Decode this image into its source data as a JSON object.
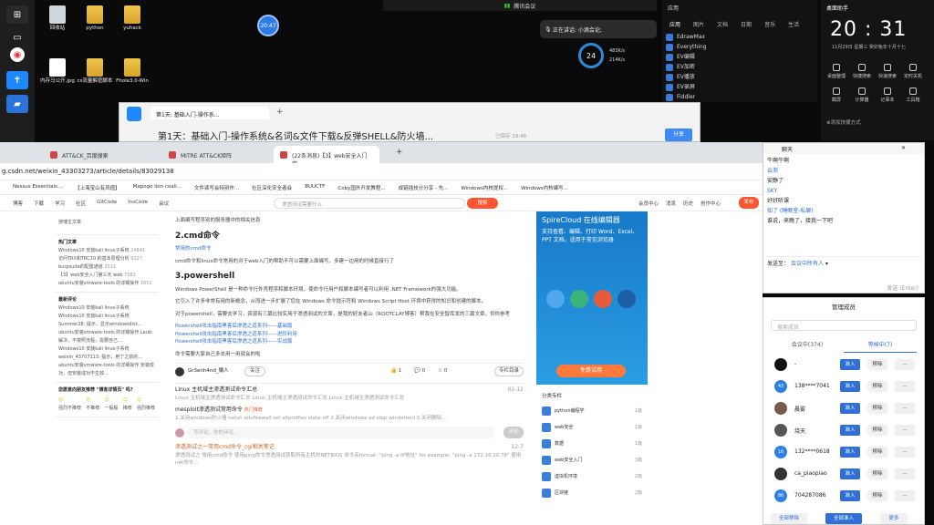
{
  "desktop": {
    "icons": [
      {
        "label": "回收站"
      },
      {
        "label": "python"
      },
      {
        "label": "yuhack"
      },
      {
        "label": "内存马公开.jpg"
      },
      {
        "label": "cs流量解密脚本"
      },
      {
        "label": "Fhole3.0-Win"
      }
    ],
    "bubble": "20:47",
    "top_status": "腾讯会议",
    "meeting": "正在讲话: 小滴会论;",
    "net": {
      "percent": "24",
      "up": "483K/s",
      "down": "214K/s"
    }
  },
  "app_window": {
    "title": "应用",
    "tabs": [
      "应用",
      "图片",
      "文档",
      "日期",
      "音乐",
      "生活"
    ],
    "items": [
      "EdrawMax",
      "Everything",
      "EV编辑",
      "EV加密",
      "EV播放",
      "EV录屏",
      "Fiddler"
    ]
  },
  "clock_panel": {
    "title": "桌面助手",
    "time": "20 : 31",
    "date": "11月29日 星期三",
    "lunar": "癸卯兔年十月十七",
    "controls": [
      "桌面整理",
      "快捷搜索",
      "快速搜索",
      "定时关机",
      "截屏",
      "计算器",
      "记事本",
      "工具箱"
    ],
    "more": "⊕添加快捷方式"
  },
  "doc_window": {
    "tab": "第1天: 基础入门-操作系...",
    "title": "第1天：基础入门-操作系统&名词&文件下载&反弹SHELL&防火墙...",
    "share": "分享",
    "saved": "已保存 19:48"
  },
  "browser": {
    "tabs": [
      "ATT&CK_百度搜索",
      "MITRE ATT&CK矩阵",
      "(22条消息)【3】web安全入门学",
      "+"
    ],
    "url": "g.csdn.net/weixin_43303273/article/details/83029138",
    "bookmarks": [
      "Nessus Essentials...",
      "【上海宝山有风值】",
      "Mapogo lion coali...",
      "文件读写会特别作...",
      "社区深化安全者会",
      "BUUCTF",
      "Coby国外开发教程...",
      "成链插技分分享 - 先...",
      "Windows内核提权...",
      "Windows内核编写..."
    ],
    "csdn_nav": [
      "博客",
      "下载",
      "学习",
      "社区",
      "GitCode",
      "InsCode",
      "会议"
    ],
    "search_placeholder": "渗透测试需要什么",
    "search_btn": "搜索",
    "user_nav": [
      "会员中心",
      "消息",
      "历史",
      "创作中心",
      "发布"
    ]
  },
  "sidebar": {
    "search_placeholder": "搜博主文章",
    "hot_title": "热门文章",
    "hot": [
      {
        "t": "Windows10 安装kali linux子系统",
        "n": "24841"
      },
      {
        "t": "访问TRX和TRC10 的基本原理分析",
        "n": "9327"
      },
      {
        "t": "burpsuite的配置通道",
        "n": "2521"
      },
      {
        "t": "【3】web安全入门第三天 web",
        "n": "7581"
      },
      {
        "t": "ubuntu安装vmware-tools 的详细操作",
        "n": "1651"
      }
    ],
    "comments_title": "最新评论",
    "comments": [
      "Windows10 安装kali linux子系统",
      "Windows10 安装kali linux子系统 Summer28: 提示，显示windowsdist...",
      "ubuntu安装vmware-tools 的详细操作 Laub: 解决，不按照流程，需要自己...",
      "Windows10 安装kali linux子系统 weixin_43707113: 提示，用了之前的...",
      "ubuntu安装vmware-tools 的详细操作 安装成功，但安装成功不生效..."
    ],
    "vote_title": "您愿意向朋友推荐 \"博客详情页\" 吗?",
    "vote": [
      "强烈不推荐",
      "不推荐",
      "一般般",
      "推荐",
      "强烈推荐"
    ]
  },
  "article": {
    "intro": "上面编写程序别的服务器中的相关信息",
    "h_cmd": "2.cmd命令",
    "cmd_link": "常用的cmd命令",
    "cmd_text": "cmd命令和linux命令常用的对于web入门的帮助不可以需要上面编写，多建一边用的时候直接行了",
    "h_ps": "3.powershell",
    "ps_text1": "Windows PowerShell 是一种命令行外壳程序和脚本环境，使命令行用户和脚本编写者可以利用 .NET Framework的强大功能。",
    "ps_text2": "它引入了许多非常有用的新概念，从而进一步扩展了您在 Windows 命令提示符和 Windows Script Host 环境中获得的知识和创建的脚本。",
    "ps_text3": "对于powershell，需要去学习，资源有三篇比较实用于渗透测试的文章，是我的好友者山（ROOTCLAY博客）帮我在安全智库发的三篇文章，供你参考",
    "links": [
      "Powershell攻击指南黑客后渗透之道系列——基础篇",
      "Powershell攻击指南黑客后渗透之道系列——进阶利用",
      "Powershell攻击指南黑客后渗透之道系列——实战篇"
    ],
    "outro": "命令需要大家自己多去用一用就会的啦",
    "author": "Gr3enh4nd_懒人",
    "follow": "关注",
    "likes": "1",
    "comments": "0",
    "stars": "0",
    "collect": "专栏目录",
    "rel1_title": "Linux 主机域主渗透测试命令汇总",
    "rel1_desc": "Linux 主机域主渗透测试命令汇总 Linux 主机域主渗透测试命令汇总 Linux 主机域主渗透测试命令汇总",
    "rel1_date": "02-12",
    "rel2_title": "mesploit渗透测试常用命令",
    "rel2_tag": "热门推荐",
    "rel2_desc": "1.关闭windows防火墙 netsh advfirewall set allprofiles state off 2.关闭windows ad stop windefend 3.关闭删除...",
    "comment_placeholder": "写评论，你的评论…",
    "comment_btn": "评论",
    "rel3_title": "渗透测试之一常用cmd命令_cgi相关笔记",
    "rel3_desc": "渗透测试之 常用cmd命令 使用ping命令渗透测试获取所有主机的NETBIOS 命令名format: \"ping -a IP地址\" for example: \"ping -a 172.16.10.78\" 使用net命令...",
    "rel3_date": "12-7"
  },
  "ad": {
    "brand": "SpireCloud 在线编辑器",
    "text": "支持查看、编辑、打印 Word、Excel、PPT 文档，适用于常见浏览器",
    "btn": "免费试用"
  },
  "tags": {
    "title": "分类专栏",
    "items": [
      {
        "t": "python编程学",
        "n": "1篇"
      },
      {
        "t": "web安全",
        "n": "1篇"
      },
      {
        "t": "数据",
        "n": "1篇"
      },
      {
        "t": "web安全入门",
        "n": "3篇"
      },
      {
        "t": "虚拟机环境",
        "n": "2篇"
      },
      {
        "t": "区块链",
        "n": "2篇"
      }
    ]
  },
  "chat": {
    "title": "聊天",
    "messages": [
      "牛啊牛啊",
      "云渐",
      "安静了",
      "SKY",
      "好好听课",
      "如了 (睡眠室-私聊)",
      "谁说，来晚了，接我一下吧"
    ],
    "to_label": "发送至：",
    "to_value": "会议中所有人",
    "send_placeholder": "发送 (Enter)"
  },
  "members": {
    "title": "管理成员",
    "search": "搜索成员",
    "tab_in": "会议中(374)",
    "tab_wait": "等候中(7)",
    "list": [
      {
        "avatar": "",
        "name": "-"
      },
      {
        "avatar": "43",
        "name": "138****7041"
      },
      {
        "avatar": "",
        "name": "晨雾"
      },
      {
        "avatar": "",
        "name": "烧天"
      },
      {
        "avatar": "16",
        "name": "132****0618"
      },
      {
        "avatar": "",
        "name": "ca_piaopiao"
      },
      {
        "avatar": "86",
        "name": "704287086"
      }
    ],
    "admit": "准入",
    "remove": "移除",
    "bottom": [
      "全部移除",
      "全部准入",
      "更多"
    ]
  }
}
